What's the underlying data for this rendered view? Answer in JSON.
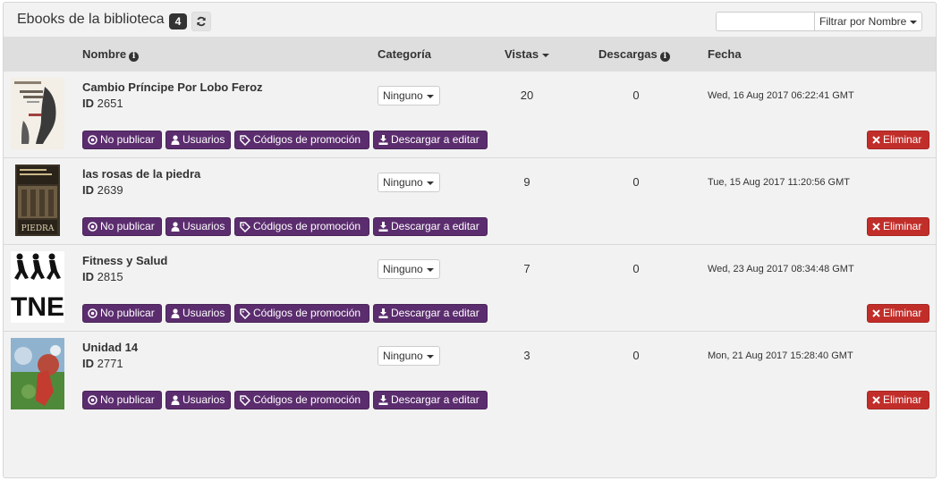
{
  "header": {
    "title": "Ebooks de la biblioteca",
    "count": "4",
    "filter_placeholder": "",
    "filter_select": "Filtrar por Nombre"
  },
  "columns": {
    "nombre": "Nombre",
    "categoria": "Categoría",
    "vistas": "Vistas",
    "descargas": "Descargas",
    "fecha": "Fecha"
  },
  "actions": {
    "unpublish": "No publicar",
    "users": "Usuarios",
    "promo": "Códigos de promoción",
    "download": "Descargar a editar",
    "delete": "Eliminar"
  },
  "rows": [
    {
      "title": "Cambio Príncipe Por Lobo Feroz",
      "id_label": "ID",
      "id": "2651",
      "category": "Ninguno",
      "views": "20",
      "downloads": "0",
      "date": "Wed, 16 Aug 2017 06:22:41 GMT"
    },
    {
      "title": "las rosas de la piedra",
      "id_label": "ID",
      "id": "2639",
      "category": "Ninguno",
      "views": "9",
      "downloads": "0",
      "date": "Tue, 15 Aug 2017 11:20:56 GMT",
      "cover_text": "PIEDRA"
    },
    {
      "title": "Fitness y Salud",
      "id_label": "ID",
      "id": "2815",
      "category": "Ninguno",
      "views": "7",
      "downloads": "0",
      "date": "Wed, 23 Aug 2017 08:34:48 GMT",
      "cover_text": "TNE"
    },
    {
      "title": "Unidad 14",
      "id_label": "ID",
      "id": "2771",
      "category": "Ninguno",
      "views": "3",
      "downloads": "0",
      "date": "Mon, 21 Aug 2017 15:28:40 GMT"
    }
  ],
  "colors": {
    "action_purple": "#5b2d6e",
    "delete_red": "#c12e2a",
    "header_gray": "#dedede",
    "panel_bg": "#f2f2f2"
  }
}
